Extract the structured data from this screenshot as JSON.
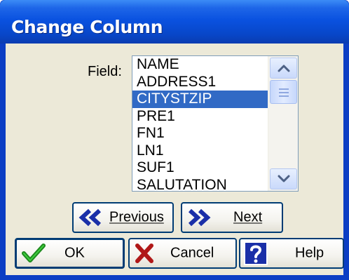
{
  "window": {
    "title": "Change Column"
  },
  "field": {
    "label": "Field:",
    "items": [
      "NAME",
      "ADDRESS1",
      "CITYSTZIP",
      "PRE1",
      "FN1",
      "LN1",
      "SUF1",
      "SALUTATION"
    ],
    "selected": "CITYSTZIP"
  },
  "buttons": {
    "previous": "Previous",
    "next": "Next",
    "ok": "OK",
    "cancel": "Cancel",
    "help": "Help"
  },
  "colors": {
    "title_bar": "#0a52e0",
    "selection": "#316ac5",
    "dialog_face": "#ece9d8",
    "button_border": "#003c74"
  },
  "icons": {
    "previous": "double-chevron-left-icon",
    "next": "double-chevron-right-icon",
    "ok": "checkmark-icon",
    "cancel": "x-icon",
    "help": "question-mark-icon"
  }
}
